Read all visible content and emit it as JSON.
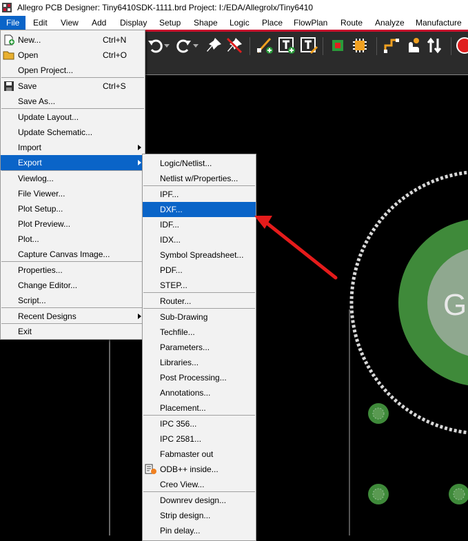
{
  "window": {
    "title": "Allegro PCB Designer: Tiny6410SDK-1111.brd  Project: I:/EDA/Allegrolx/Tiny6410"
  },
  "menubar": {
    "items": [
      "File",
      "Edit",
      "View",
      "Add",
      "Display",
      "Setup",
      "Shape",
      "Logic",
      "Place",
      "FlowPlan",
      "Route",
      "Analyze",
      "Manufacture"
    ]
  },
  "file_menu": {
    "items": [
      {
        "label": "New...",
        "shortcut": "Ctrl+N"
      },
      {
        "label": "Open",
        "shortcut": "Ctrl+O"
      },
      {
        "label": "Open Project...",
        "shortcut": ""
      },
      {
        "label": "Save",
        "shortcut": "Ctrl+S"
      },
      {
        "label": "Save As...",
        "shortcut": ""
      },
      {
        "label": "Update Layout...",
        "shortcut": ""
      },
      {
        "label": "Update Schematic...",
        "shortcut": ""
      },
      {
        "label": "Import",
        "shortcut": ""
      },
      {
        "label": "Export",
        "shortcut": ""
      },
      {
        "label": "Viewlog...",
        "shortcut": ""
      },
      {
        "label": "File Viewer...",
        "shortcut": ""
      },
      {
        "label": "Plot Setup...",
        "shortcut": ""
      },
      {
        "label": "Plot Preview...",
        "shortcut": ""
      },
      {
        "label": "Plot...",
        "shortcut": ""
      },
      {
        "label": "Capture Canvas Image...",
        "shortcut": ""
      },
      {
        "label": "Properties...",
        "shortcut": ""
      },
      {
        "label": "Change Editor...",
        "shortcut": ""
      },
      {
        "label": "Script...",
        "shortcut": ""
      },
      {
        "label": "Recent Designs",
        "shortcut": ""
      },
      {
        "label": "Exit",
        "shortcut": ""
      }
    ]
  },
  "export_menu": {
    "items": [
      "Logic/Netlist...",
      "Netlist w/Properties...",
      "IPF...",
      "DXF...",
      "IDF...",
      "IDX...",
      "Symbol Spreadsheet...",
      "PDF...",
      "STEP...",
      "Router...",
      "Sub-Drawing",
      "Techfile...",
      "Parameters...",
      "Libraries...",
      "Post Processing...",
      "Annotations...",
      "Placement...",
      "IPC 356...",
      "IPC 2581...",
      "Fabmaster out",
      "ODB++ inside...",
      "Creo View...",
      "Downrev design...",
      "Strip design...",
      "Pin delay..."
    ]
  },
  "canvas": {
    "pad_text": "G"
  },
  "colors": {
    "highlight": "#0a64c8",
    "accent_red": "#c8102e",
    "pad_green": "#3f8a3a"
  }
}
